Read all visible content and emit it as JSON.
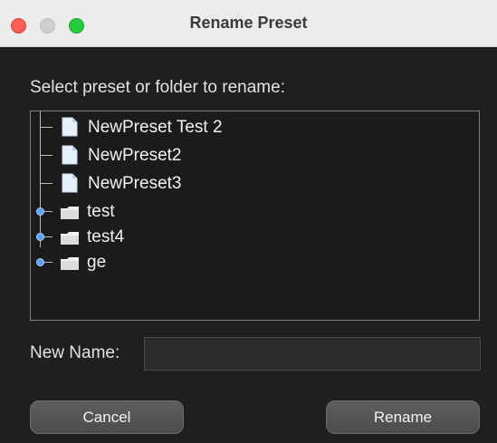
{
  "window": {
    "title": "Rename Preset",
    "traffic_lights": [
      "close",
      "minimize",
      "zoom"
    ]
  },
  "dialog": {
    "prompt": "Select preset or folder to rename:",
    "tree": {
      "items": [
        {
          "type": "file",
          "icon": "document-icon",
          "label": "NewPreset Test 2"
        },
        {
          "type": "file",
          "icon": "document-icon",
          "label": "NewPreset2"
        },
        {
          "type": "file",
          "icon": "document-icon",
          "label": "NewPreset3"
        },
        {
          "type": "folder",
          "icon": "folder-icon",
          "label": "test"
        },
        {
          "type": "folder",
          "icon": "folder-icon",
          "label": "test4"
        },
        {
          "type": "folder",
          "icon": "folder-icon",
          "label": "ge"
        }
      ]
    },
    "new_name": {
      "label": "New Name:",
      "value": "",
      "placeholder": ""
    },
    "buttons": {
      "cancel": "Cancel",
      "rename": "Rename"
    }
  },
  "colors": {
    "background": "#1f1f1f",
    "titlebar": "#ececec",
    "close": "#ff5f57",
    "zoom": "#27c93f",
    "expander": "#5aa2ff"
  }
}
